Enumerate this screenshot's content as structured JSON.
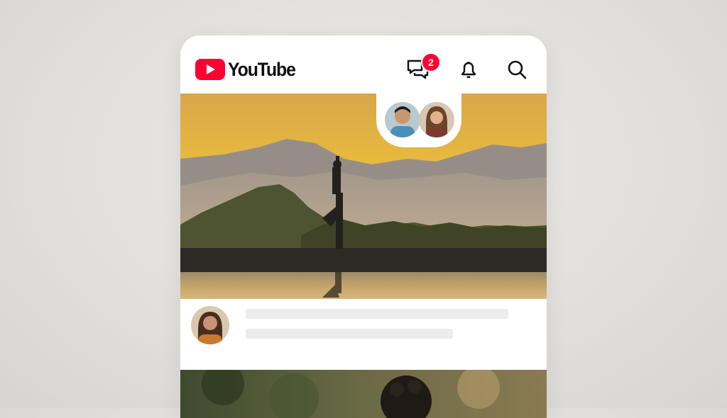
{
  "app": {
    "brand_name": "YouTube",
    "brand_color": "#ff0033"
  },
  "header": {
    "icons": [
      "youtube-logo-icon",
      "chat-bubbles-icon",
      "bell-icon",
      "search-icon"
    ],
    "chat_badge_count": "2"
  },
  "hero": {
    "description_icons": [
      "shared-viewer-avatar-1",
      "shared-viewer-avatar-2"
    ]
  },
  "post": {
    "avatar": "creator-avatar",
    "lines": [
      "skeleton-title-line",
      "skeleton-subtitle-line"
    ]
  }
}
